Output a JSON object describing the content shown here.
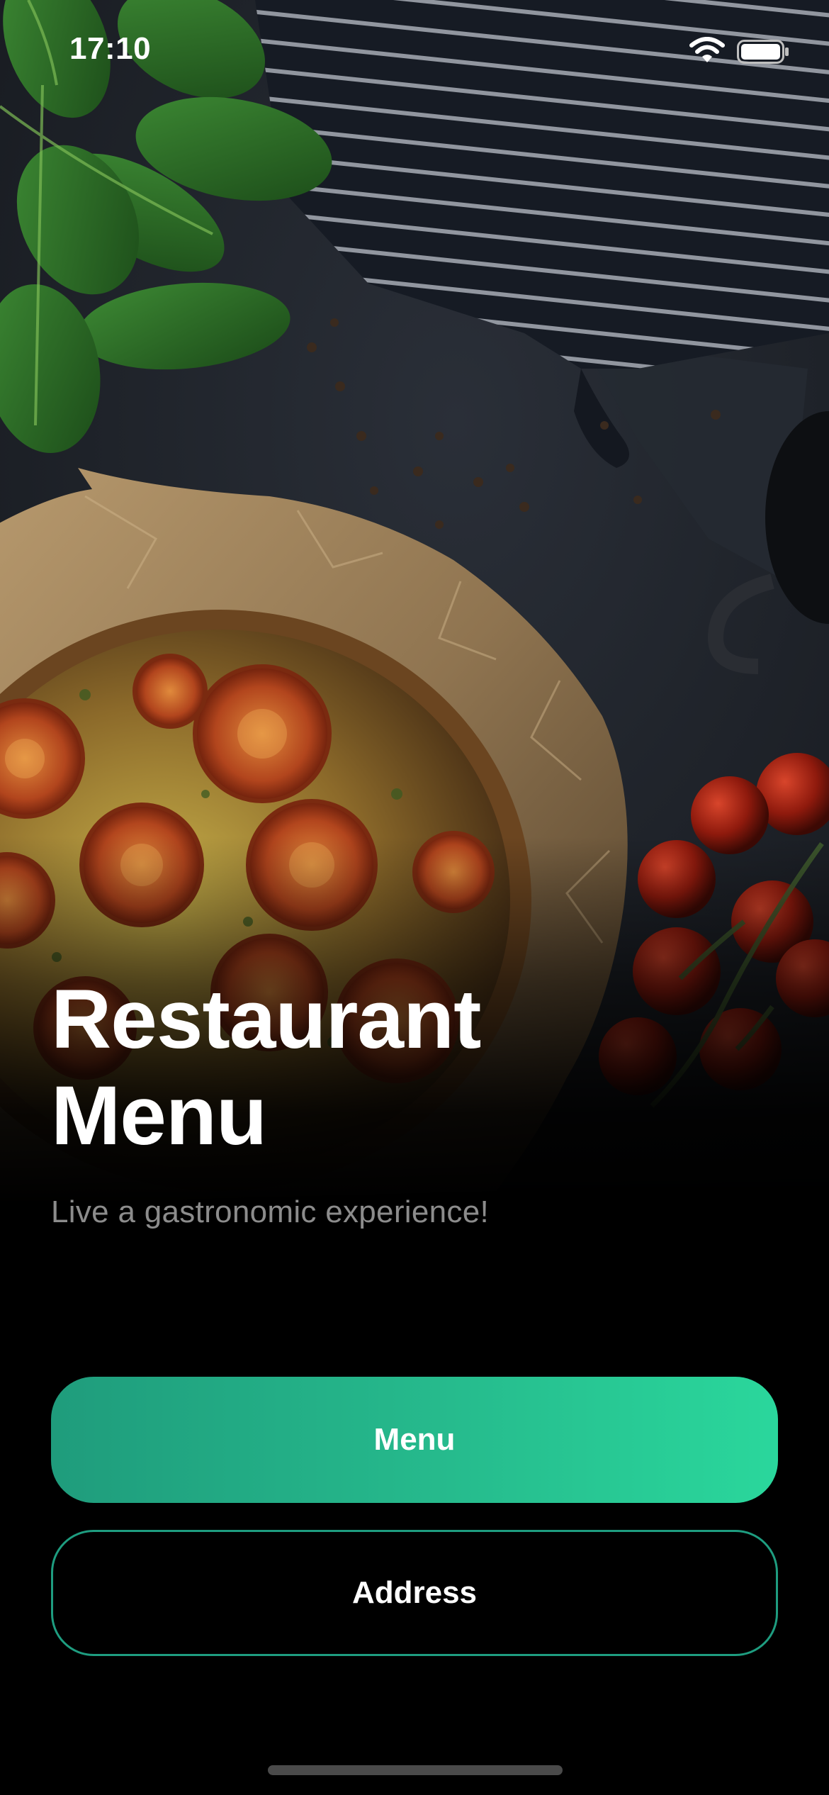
{
  "status_bar": {
    "time": "17:10",
    "wifi_icon": "wifi-icon",
    "battery_icon": "battery-icon"
  },
  "hero": {
    "image": "quiche-with-tomatoes-photo"
  },
  "title_line1": "Restaurant",
  "title_line2": "Menu",
  "subtitle": "Live a gastronomic experience!",
  "buttons": {
    "menu_label": "Menu",
    "address_label": "Address"
  },
  "colors": {
    "background": "#000000",
    "accent_start": "#1f9c7c",
    "accent_end": "#2ad79c",
    "outline": "#1e9d80",
    "subtitle_text": "#8c8c8c"
  }
}
